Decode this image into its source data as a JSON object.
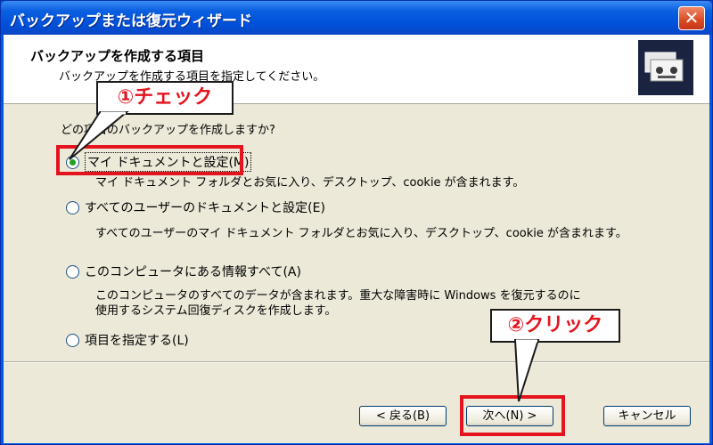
{
  "window": {
    "title": "バックアップまたは復元ウィザード",
    "close_glyph": "✕"
  },
  "header": {
    "title": "バックアップを作成する項目",
    "subtitle": "バックアップを作成する項目を指定してください。",
    "icon": "backup-tapes-icon"
  },
  "main": {
    "question": "どの項目のバックアップを作成しますか?",
    "options": [
      {
        "label": "マイ ドキュメントと設定(M)",
        "selected": true,
        "description": [
          "マイ ドキュメント フォルダとお気に入り、デスクトップ、cookie が含まれます。"
        ]
      },
      {
        "label": "すべてのユーザーのドキュメントと設定(E)",
        "selected": false,
        "description": [
          "すべてのユーザーのマイ ドキュメント フォルダとお気に入り、デスクトップ、cookie が含まれます。"
        ]
      },
      {
        "label": "このコンピュータにある情報すべて(A)",
        "selected": false,
        "description": [
          "このコンピュータのすべてのデータが含まれます。重大な障害時に Windows を復元するのに",
          "使用するシステム回復ディスクを作成します。"
        ]
      },
      {
        "label": "項目を指定する(L)",
        "selected": false,
        "description": []
      }
    ]
  },
  "buttons": {
    "back": "< 戻る(B)",
    "next": "次へ(N) >",
    "cancel": "キャンセル"
  },
  "annotations": {
    "callout1": "①チェック",
    "callout2": "②クリック",
    "highlight_color": "#e4141e"
  },
  "colors": {
    "titlebar": "#0a5fe0",
    "dialog_bg": "#ece9d8",
    "radio_dot": "#21a121",
    "close_button": "#d84a22"
  }
}
